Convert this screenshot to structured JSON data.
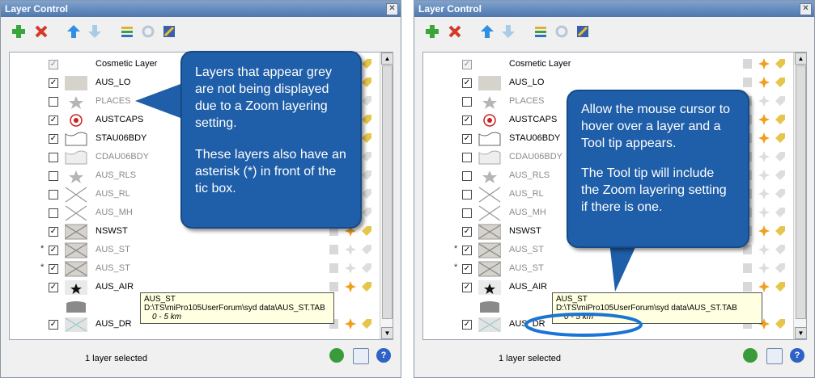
{
  "panels": [
    {
      "title": "Layer Control",
      "status": "1 layer selected",
      "layers": [
        {
          "name": "Cosmetic Layer",
          "grey": false,
          "checked": true,
          "dim": true,
          "asterisk": ""
        },
        {
          "name": "AUS_LO",
          "grey": false,
          "checked": true,
          "dim": false,
          "asterisk": ""
        },
        {
          "name": "PLACES",
          "grey": true,
          "checked": false,
          "dim": false,
          "asterisk": ""
        },
        {
          "name": "AUSTCAPS",
          "grey": false,
          "checked": true,
          "dim": false,
          "asterisk": ""
        },
        {
          "name": "STAU06BDY",
          "grey": false,
          "checked": true,
          "dim": false,
          "asterisk": ""
        },
        {
          "name": "CDAU06BDY",
          "grey": true,
          "checked": false,
          "dim": false,
          "asterisk": ""
        },
        {
          "name": "AUS_RLS",
          "grey": true,
          "checked": false,
          "dim": false,
          "asterisk": ""
        },
        {
          "name": "AUS_RL",
          "grey": true,
          "checked": false,
          "dim": false,
          "asterisk": ""
        },
        {
          "name": "AUS_MH",
          "grey": true,
          "checked": false,
          "dim": false,
          "asterisk": ""
        },
        {
          "name": "NSWST",
          "grey": false,
          "checked": true,
          "dim": false,
          "asterisk": ""
        },
        {
          "name": "AUS_ST",
          "grey": true,
          "checked": true,
          "dim": false,
          "asterisk": "*"
        },
        {
          "name": "AUS_ST",
          "grey": true,
          "checked": true,
          "dim": false,
          "asterisk": "*"
        },
        {
          "name": "AUS_AIR",
          "grey": false,
          "checked": true,
          "dim": false,
          "asterisk": ""
        },
        {
          "name": "",
          "grey": false,
          "checked": false,
          "dim": false,
          "asterisk": "",
          "hidebox": true
        },
        {
          "name": "AUS_DR",
          "grey": false,
          "checked": true,
          "dim": false,
          "asterisk": ""
        }
      ],
      "tooltip": {
        "line1": "AUS_ST",
        "line2": "D:\\TS\\miPro105UserForum\\syd data\\AUS_ST.TAB",
        "line3": "0 - 5 km"
      },
      "callout": {
        "p1": "Layers that appear grey are not being displayed due to a Zoom layering setting.",
        "p2": "These layers also have an asterisk (*) in front of the tic box."
      }
    },
    {
      "title": "Layer Control",
      "status": "1 layer selected",
      "layers": [
        {
          "name": "Cosmetic Layer",
          "grey": false,
          "checked": true,
          "dim": true,
          "asterisk": ""
        },
        {
          "name": "AUS_LO",
          "grey": false,
          "checked": true,
          "dim": false,
          "asterisk": ""
        },
        {
          "name": "PLACES",
          "grey": true,
          "checked": false,
          "dim": false,
          "asterisk": ""
        },
        {
          "name": "AUSTCAPS",
          "grey": false,
          "checked": true,
          "dim": false,
          "asterisk": ""
        },
        {
          "name": "STAU06BDY",
          "grey": false,
          "checked": true,
          "dim": false,
          "asterisk": ""
        },
        {
          "name": "CDAU06BDY",
          "grey": true,
          "checked": false,
          "dim": false,
          "asterisk": ""
        },
        {
          "name": "AUS_RLS",
          "grey": true,
          "checked": false,
          "dim": false,
          "asterisk": ""
        },
        {
          "name": "AUS_RL",
          "grey": true,
          "checked": false,
          "dim": false,
          "asterisk": ""
        },
        {
          "name": "AUS_MH",
          "grey": true,
          "checked": false,
          "dim": false,
          "asterisk": ""
        },
        {
          "name": "NSWST",
          "grey": false,
          "checked": true,
          "dim": false,
          "asterisk": ""
        },
        {
          "name": "AUS_ST",
          "grey": true,
          "checked": true,
          "dim": false,
          "asterisk": "*"
        },
        {
          "name": "AUS_ST",
          "grey": true,
          "checked": true,
          "dim": false,
          "asterisk": "*"
        },
        {
          "name": "AUS_AIR",
          "grey": false,
          "checked": true,
          "dim": false,
          "asterisk": ""
        },
        {
          "name": "",
          "grey": false,
          "checked": false,
          "dim": false,
          "asterisk": "",
          "hidebox": true
        },
        {
          "name": "AUS_DR",
          "grey": false,
          "checked": true,
          "dim": false,
          "asterisk": ""
        }
      ],
      "tooltip": {
        "line1": "AUS_ST",
        "line2": "D:\\TS\\miPro105UserForum\\syd data\\AUS_ST.TAB",
        "line3": "0 - 5 km"
      },
      "callout": {
        "p1": "Allow the mouse cursor to hover over a layer and a Tool tip appears.",
        "p2": "The Tool tip will include the Zoom layering setting if there is one."
      }
    }
  ],
  "colors": {
    "accent": "#1f5ea8",
    "highlight_ellipse": "#1a74d6",
    "tooltip_bg": "#ffffe1"
  }
}
